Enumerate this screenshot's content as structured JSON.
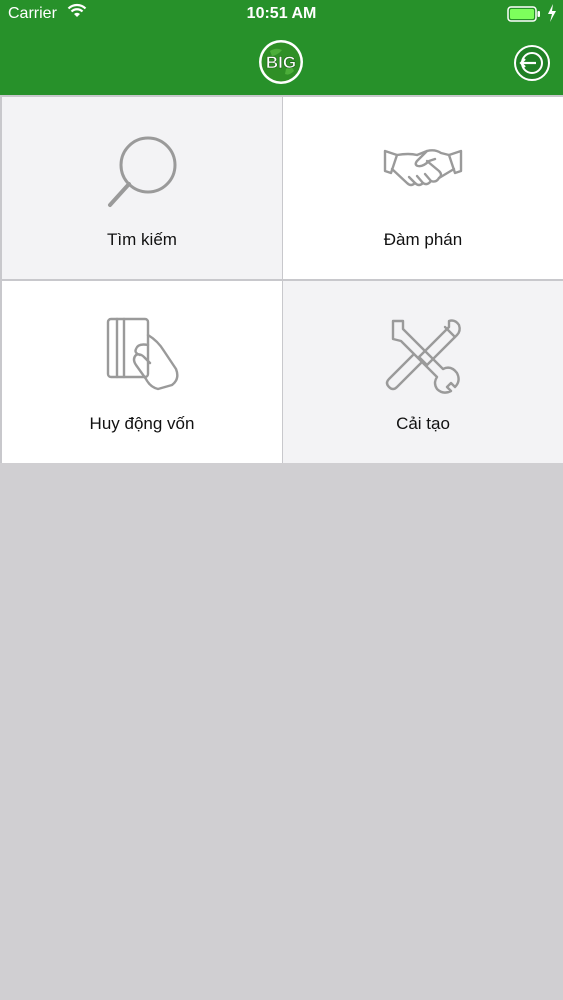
{
  "status_bar": {
    "carrier": "Carrier",
    "time": "10:51 AM"
  },
  "nav": {
    "logo_text": "BIG",
    "brand_color": "#27912a"
  },
  "menu": [
    {
      "label": "Tìm kiếm",
      "icon": "search-icon"
    },
    {
      "label": "Đàm phán",
      "icon": "handshake-icon"
    },
    {
      "label": "Huy động vốn",
      "icon": "card-hand-icon"
    },
    {
      "label": "Cải tạo",
      "icon": "tools-icon"
    }
  ]
}
